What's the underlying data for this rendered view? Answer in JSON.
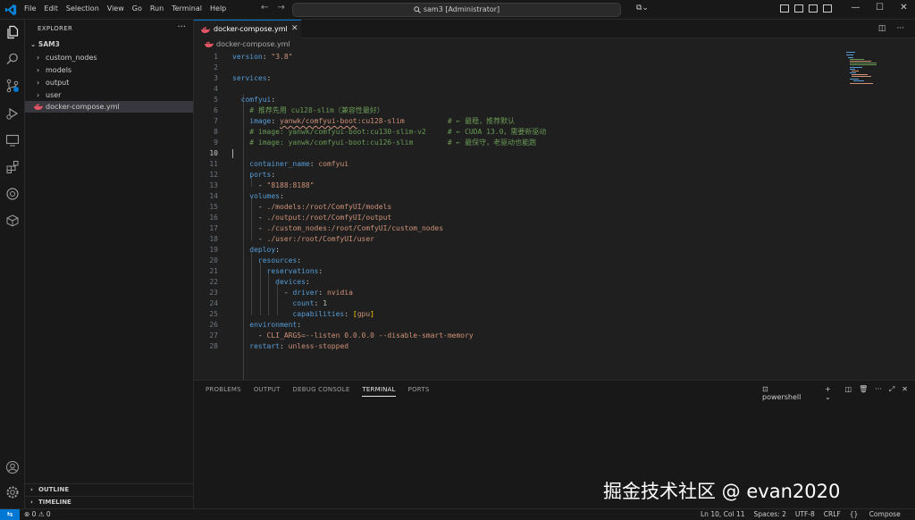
{
  "titlebar": {
    "menu": [
      "File",
      "Edit",
      "Selection",
      "View",
      "Go",
      "Run",
      "Terminal",
      "Help"
    ],
    "search": "sam3 [Administrator]"
  },
  "explorer": {
    "title": "EXPLORER",
    "root": "SAM3",
    "items": [
      {
        "label": "custom_nodes",
        "type": "folder"
      },
      {
        "label": "models",
        "type": "folder"
      },
      {
        "label": "output",
        "type": "folder"
      },
      {
        "label": "user",
        "type": "folder"
      },
      {
        "label": "docker-compose.yml",
        "type": "file"
      }
    ],
    "outline": "OUTLINE",
    "timeline": "TIMELINE"
  },
  "editor": {
    "tab": "docker-compose.yml",
    "breadcrumb": "docker-compose.yml",
    "cursor_line": 10,
    "lines": [
      "version: \"3.8\"",
      "",
      "services:",
      "",
      "  comfyui:",
      "    # 推荐先用 cu128-slim（兼容性最好）",
      "    image: yanwk/comfyui-boot:cu128-slim          # ← 最稳，推荐默认",
      "    # image: yanwk/comfyui-boot:cu130-slim-v2     # ← CUDA 13.0，需要新驱动",
      "    # image: yanwk/comfyui-boot:cu126-slim        # ← 最保守，老驱动也能跑",
      "",
      "    container_name: comfyui",
      "    ports:",
      "      - \"8188:8188\"",
      "    volumes:",
      "      - ./models:/root/ComfyUI/models",
      "      - ./output:/root/ComfyUI/output",
      "      - ./custom_nodes:/root/ComfyUI/custom_nodes",
      "      - ./user:/root/ComfyUI/user",
      "    deploy:",
      "      resources:",
      "        reservations:",
      "          devices:",
      "            - driver: nvidia",
      "              count: 1",
      "              capabilities: [gpu]",
      "    environment:",
      "      - CLI_ARGS=--listen 0.0.0.0 --disable-smart-memory",
      "    restart: unless-stopped"
    ]
  },
  "panel": {
    "tabs": [
      "PROBLEMS",
      "OUTPUT",
      "DEBUG CONSOLE",
      "TERMINAL",
      "PORTS"
    ],
    "active_tab": "TERMINAL",
    "shell": "powershell"
  },
  "watermark": "掘金技术社区 @ evan2020",
  "statusbar": {
    "problems": "⊗ 0 ⚠ 0",
    "position": "Ln 10, Col 11",
    "spaces": "Spaces: 2",
    "encoding": "UTF-8",
    "eol": "CRLF",
    "language": "Compose"
  },
  "colors": {
    "accent": "#0078d4",
    "keyword": "#569cd6",
    "string": "#ce9178",
    "comment": "#6a9955",
    "number": "#b5cea8",
    "docker": "#e55565"
  }
}
